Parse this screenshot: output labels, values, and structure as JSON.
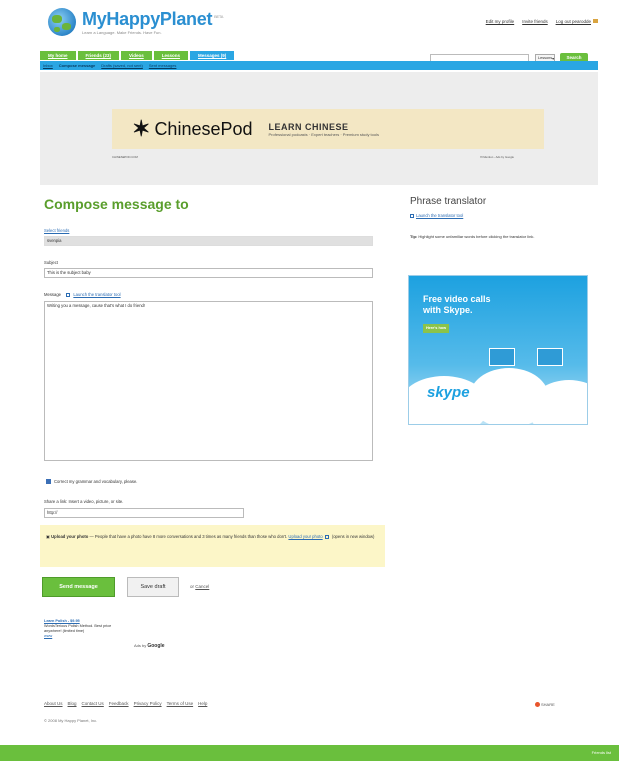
{
  "brand": {
    "name": "MyHappyPlanet",
    "beta": "BETA",
    "tagline": "Learn a Language. Make Friends. Have Fun."
  },
  "top_links": [
    "Edit my profile",
    "Invite friends",
    "Log out pearodde"
  ],
  "nav": {
    "tabs": [
      "My home",
      "Friends (23)",
      "Videos",
      "Lessons",
      "Messages (9)"
    ]
  },
  "search": {
    "placeholder": "",
    "select_value": "Lessons",
    "button": "Search"
  },
  "subnav": [
    "Inbox",
    "Compose message",
    "Drafts (saved, not sent)",
    "Sent messages"
  ],
  "ad": {
    "brand": "ChinesePod",
    "headline": "LEARN CHINESE",
    "sub": "Professional podcasts · Expert teachers · Premium study tools",
    "left_small": "CHINESEPOD.COM",
    "right_small": "I'll Mention - Ads by Google"
  },
  "compose": {
    "title": "Compose message to",
    "select_friends": "Select friends",
    "to_value": "svenpia",
    "subject_label": "Subject",
    "subject_value": "This is the subject baby",
    "message_label": "Message",
    "translator_link": "Launch the translator tool",
    "message_value": "Writing you a message, cause that's what I do friend!",
    "correct_label": "Correct my grammar and vocabulary, please.",
    "share_label": "Share a link: Insert a video, picture, or site.",
    "share_value": "http://",
    "photo_bold": "Upload your photo",
    "photo_text": " — People that have a photo have 8 more conversations and 3 times as many friends than those who don't. ",
    "photo_link": "Upload your photo",
    "photo_tail": " (opens in new window)",
    "send": "Send message",
    "draft": "Save draft",
    "or": "or",
    "cancel": "Cancel"
  },
  "gads": {
    "title": "Learn Polish - $9.95",
    "line1": "WordsTerious Polish Method. Best price",
    "line2": "anywhere! (limited time)",
    "url": "www",
    "byline": "Ads by",
    "google": "Google"
  },
  "sidebar": {
    "title": "Phrase translator",
    "link": "Launch the translator tool",
    "tip_bold": "Tip:",
    "tip": " Highlight some unfamiliar words before clicking the translator link."
  },
  "skype_ad": {
    "headline1": "Free video calls",
    "headline2": "with Skype.",
    "button": "Here's how",
    "logo": "skype"
  },
  "footer": {
    "links": [
      "About Us",
      "Blog",
      "Contact Us",
      "Feedback",
      "Privacy Policy",
      "Terms of Use",
      "Help"
    ],
    "copyright": "© 2008 My Happy Planet, Inc.",
    "share": "SHARE"
  },
  "bottom_bar": {
    "label": "Friends list"
  }
}
